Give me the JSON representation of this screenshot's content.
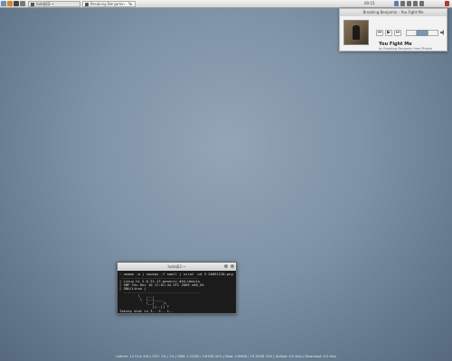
{
  "taskbar": {
    "launchers": [
      {
        "icon": "home-icon",
        "color": "#6b8fb8"
      },
      {
        "icon": "browser-icon",
        "color": "#d9822b"
      },
      {
        "icon": "terminal-icon",
        "color": "#444444"
      },
      {
        "icon": "files-icon",
        "color": "#7a7a7a"
      }
    ],
    "tasks": [
      {
        "label": "hotdj62:~"
      },
      {
        "label": "Breaking Benjamin - Yo..."
      }
    ],
    "clock": "00:15",
    "tray": [
      {
        "icon": "music-icon",
        "color": "#5a7fa8"
      },
      {
        "icon": "network-icon",
        "color": "#6f6f6f"
      },
      {
        "icon": "volume-icon",
        "color": "#6f6f6f"
      },
      {
        "icon": "battery-icon",
        "color": "#6f6f6f"
      },
      {
        "icon": "mail-icon",
        "color": "#6f6f6f"
      },
      {
        "icon": "power-icon",
        "color": "#b03a2e"
      }
    ]
  },
  "music_player": {
    "window_title": "Breaking Benjamin - You Fight Me",
    "song": "You Fight Me",
    "artist": "by Breaking Benjamin from Phobia",
    "controls": {
      "prev": "⏮",
      "play": "▶",
      "next": "⏭"
    },
    "segments": [
      "",
      "",
      ""
    ],
    "volume_icon": "speaker-icon"
  },
  "terminal": {
    "title": "hotdj62:~",
    "lines": [
      "~ uname -a | cowsay -f small | scrot -cd 3 20091218.png",
      " _____________________________________",
      "( Linux hi 2.6.31-17-generic #54-Ubuntu",
      "( SMP Thu Dec 10 17:01:44 UTC 2009 x86_64",
      "( GNU/Linux )",
      "  -------------------------------------",
      "         \\   ,__,",
      "          \\  (..)____",
      "             (__)    )\\",
      "                ||--|| *",
      "Taking shot in 3.. 2.. 1.."
    ]
  },
  "status_bar": {
    "text": "Uptime: 1h 51m 43s  |  CPU: 1% / 1%  |  RAM: 1.24GB / 3.87GB 32%  |  Root: 2.86GB / 19.35GB 15%  |  Upload: 0.0  kb/s  |  Download: 0.0  kb/s"
  }
}
